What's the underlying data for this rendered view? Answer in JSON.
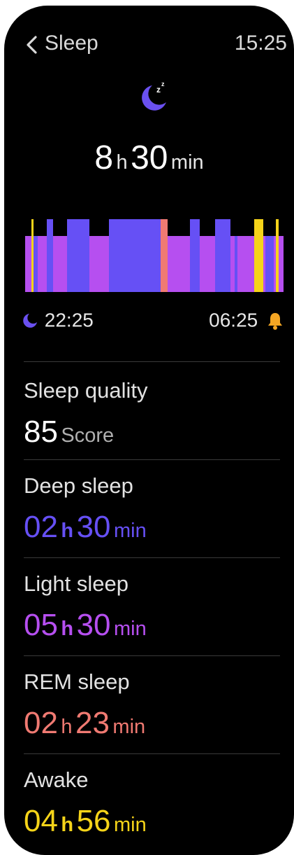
{
  "header": {
    "title": "Sleep",
    "time": "15:25"
  },
  "summary": {
    "hours": "8",
    "hours_unit": "h",
    "minutes": "30",
    "minutes_unit": "min"
  },
  "timeline": {
    "start": "22:25",
    "end": "06:25"
  },
  "quality": {
    "label": "Sleep quality",
    "value": "85",
    "unit": "Score"
  },
  "stages": [
    {
      "label": "Deep sleep",
      "h": "02",
      "h_unit": "h",
      "m": "30",
      "m_unit": "min",
      "color": "#6650f5"
    },
    {
      "label": "Light sleep",
      "h": "05",
      "h_unit": "h",
      "m": "30",
      "m_unit": "min",
      "color": "#b64ff0"
    },
    {
      "label": "REM sleep",
      "h": "02",
      "h_unit": "h",
      "m": "23",
      "m_unit": "min",
      "color": "#f07a72"
    },
    {
      "label": "Awake",
      "h": "04",
      "h_unit": "h",
      "m": "56",
      "m_unit": "min",
      "color": "#f6d419"
    }
  ],
  "colors": {
    "deep": "#6650f5",
    "light": "#b64ff0",
    "rem": "#f07a72",
    "awake": "#f6d419",
    "alarm": "#f5a623"
  }
}
